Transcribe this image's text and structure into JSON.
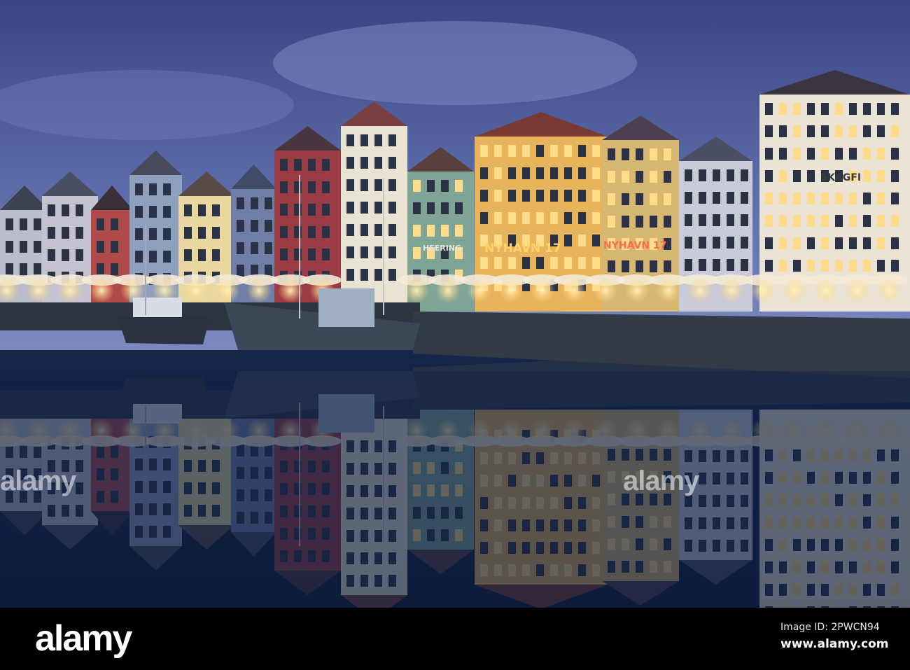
{
  "photo": {
    "subject": "Nyhavn harbour at dusk",
    "signs": {
      "nyhavn_neon": "NYHAVN 17",
      "nyhavn_facade": "NYHAVN 17",
      "heering": "HEERING",
      "skagfi": "SKAGFI"
    },
    "colors": {
      "sky_top": "#3c4a86",
      "sky_bottom": "#6f7fb6",
      "water": "#0f2040",
      "lights": "#ffd98a"
    }
  },
  "watermark": {
    "text": "alamy"
  },
  "footer": {
    "logo": "alamy",
    "image_id": "Image ID: 2PWCN94",
    "website": "www.alamy.com"
  }
}
